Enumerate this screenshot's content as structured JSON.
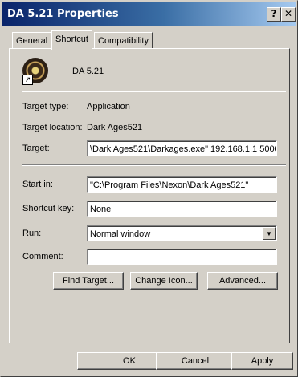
{
  "window": {
    "title": "DA 5.21 Properties",
    "help_glyph": "?",
    "close_glyph": "✕"
  },
  "tabs": [
    {
      "label": "General"
    },
    {
      "label": "Shortcut"
    },
    {
      "label": "Compatibility"
    }
  ],
  "shortcut": {
    "name": "DA 5.21",
    "target_type_label": "Target type:",
    "target_type_value": "Application",
    "target_location_label": "Target location:",
    "target_location_value": "Dark Ages521",
    "target_label": "Target:",
    "target_value": "\\Dark Ages521\\Darkages.exe\" 192.168.1.1 5000",
    "start_in_label": "Start in:",
    "start_in_value": "\"C:\\Program Files\\Nexon\\Dark Ages521\"",
    "shortcut_key_label": "Shortcut key:",
    "shortcut_key_value": "None",
    "run_label": "Run:",
    "run_value": "Normal window",
    "comment_label": "Comment:",
    "comment_value": "",
    "find_target_label": "Find Target...",
    "change_icon_label": "Change Icon...",
    "advanced_label": "Advanced..."
  },
  "footer": {
    "ok_label": "OK",
    "cancel_label": "Cancel",
    "apply_label": "Apply"
  },
  "icons": {
    "app_icon": "dark-ages-app-icon",
    "shortcut_arrow": "shortcut-arrow-icon"
  }
}
